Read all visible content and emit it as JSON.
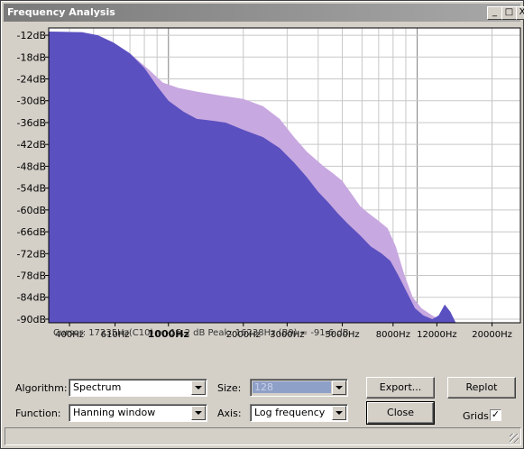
{
  "window": {
    "title": "Frequency Analysis"
  },
  "title_buttons": {
    "minimize": "_",
    "maximize": "□",
    "close": "X"
  },
  "chart_data": {
    "type": "area",
    "ylabels": [
      "-12dB",
      "-18dB",
      "-24dB",
      "-30dB",
      "-36dB",
      "-42dB",
      "-48dB",
      "-54dB",
      "-60dB",
      "-66dB",
      "-72dB",
      "-78dB",
      "-84dB",
      "-90dB"
    ],
    "xlabels": [
      "400Hz",
      "610Hz",
      "1000Hz",
      "2000Hz",
      "3000Hz",
      "5000Hz",
      "8000Hz",
      "12000Hz",
      "20000Hz"
    ],
    "xlabel_values": [
      400,
      610,
      1000,
      2000,
      3000,
      5000,
      8000,
      12000,
      20000
    ],
    "xlim": [
      330,
      26000
    ],
    "ylim": [
      -91,
      -10
    ],
    "log_x": true,
    "grid": true,
    "series": [
      {
        "color": "#c8a8e0",
        "points": [
          [
            330,
            -11
          ],
          [
            450,
            -11.2
          ],
          [
            520,
            -12
          ],
          [
            600,
            -14
          ],
          [
            700,
            -17
          ],
          [
            820,
            -21
          ],
          [
            950,
            -25
          ],
          [
            1100,
            -26.5
          ],
          [
            1300,
            -27.5
          ],
          [
            1600,
            -28.5
          ],
          [
            2000,
            -29.5
          ],
          [
            2400,
            -31.5
          ],
          [
            2800,
            -35
          ],
          [
            3200,
            -40
          ],
          [
            3600,
            -44
          ],
          [
            4200,
            -48
          ],
          [
            4600,
            -50
          ],
          [
            5000,
            -52
          ],
          [
            5500,
            -56
          ],
          [
            5900,
            -59
          ],
          [
            6400,
            -61
          ],
          [
            7000,
            -63
          ],
          [
            7600,
            -65
          ],
          [
            8200,
            -70
          ],
          [
            8900,
            -78
          ],
          [
            9600,
            -84
          ],
          [
            10400,
            -87
          ],
          [
            11500,
            -89
          ],
          [
            13000,
            -91
          ]
        ]
      },
      {
        "color": "#5a50c0",
        "points": [
          [
            330,
            -11
          ],
          [
            450,
            -11.2
          ],
          [
            520,
            -12
          ],
          [
            600,
            -14
          ],
          [
            700,
            -17
          ],
          [
            800,
            -21
          ],
          [
            900,
            -26
          ],
          [
            1000,
            -30
          ],
          [
            1150,
            -33
          ],
          [
            1300,
            -35
          ],
          [
            1500,
            -35.5
          ],
          [
            1700,
            -36
          ],
          [
            2000,
            -38
          ],
          [
            2400,
            -40
          ],
          [
            2800,
            -43
          ],
          [
            3200,
            -47
          ],
          [
            3600,
            -51
          ],
          [
            4000,
            -55
          ],
          [
            4400,
            -58
          ],
          [
            4800,
            -61
          ],
          [
            5300,
            -64
          ],
          [
            5900,
            -67
          ],
          [
            6500,
            -70
          ],
          [
            7200,
            -72
          ],
          [
            7800,
            -74
          ],
          [
            8400,
            -78
          ],
          [
            9000,
            -82
          ],
          [
            9800,
            -87
          ],
          [
            10600,
            -89
          ],
          [
            11500,
            -90
          ],
          [
            12200,
            -89
          ],
          [
            12900,
            -86
          ],
          [
            13600,
            -88
          ],
          [
            14300,
            -91
          ]
        ]
      }
    ]
  },
  "cursor_text": "Cursor: 17235Hz(C10) = -15.2 dB   Peak: 16238Hz (B9) = -91.6 dB",
  "cursor_ghost": "Peak:           -91.8 dB",
  "controls": {
    "algorithm_label": "Algorithm:",
    "algorithm_value": "Spectrum",
    "function_label": "Function:",
    "function_value": "Hanning window",
    "size_label": "Size:",
    "size_value": "128",
    "axis_label": "Axis:",
    "axis_value": "Log frequency",
    "export_label": "Export...",
    "replot_label": "Replot",
    "close_label": "Close",
    "grids_label": "Grids",
    "grids_checked": "✓"
  }
}
